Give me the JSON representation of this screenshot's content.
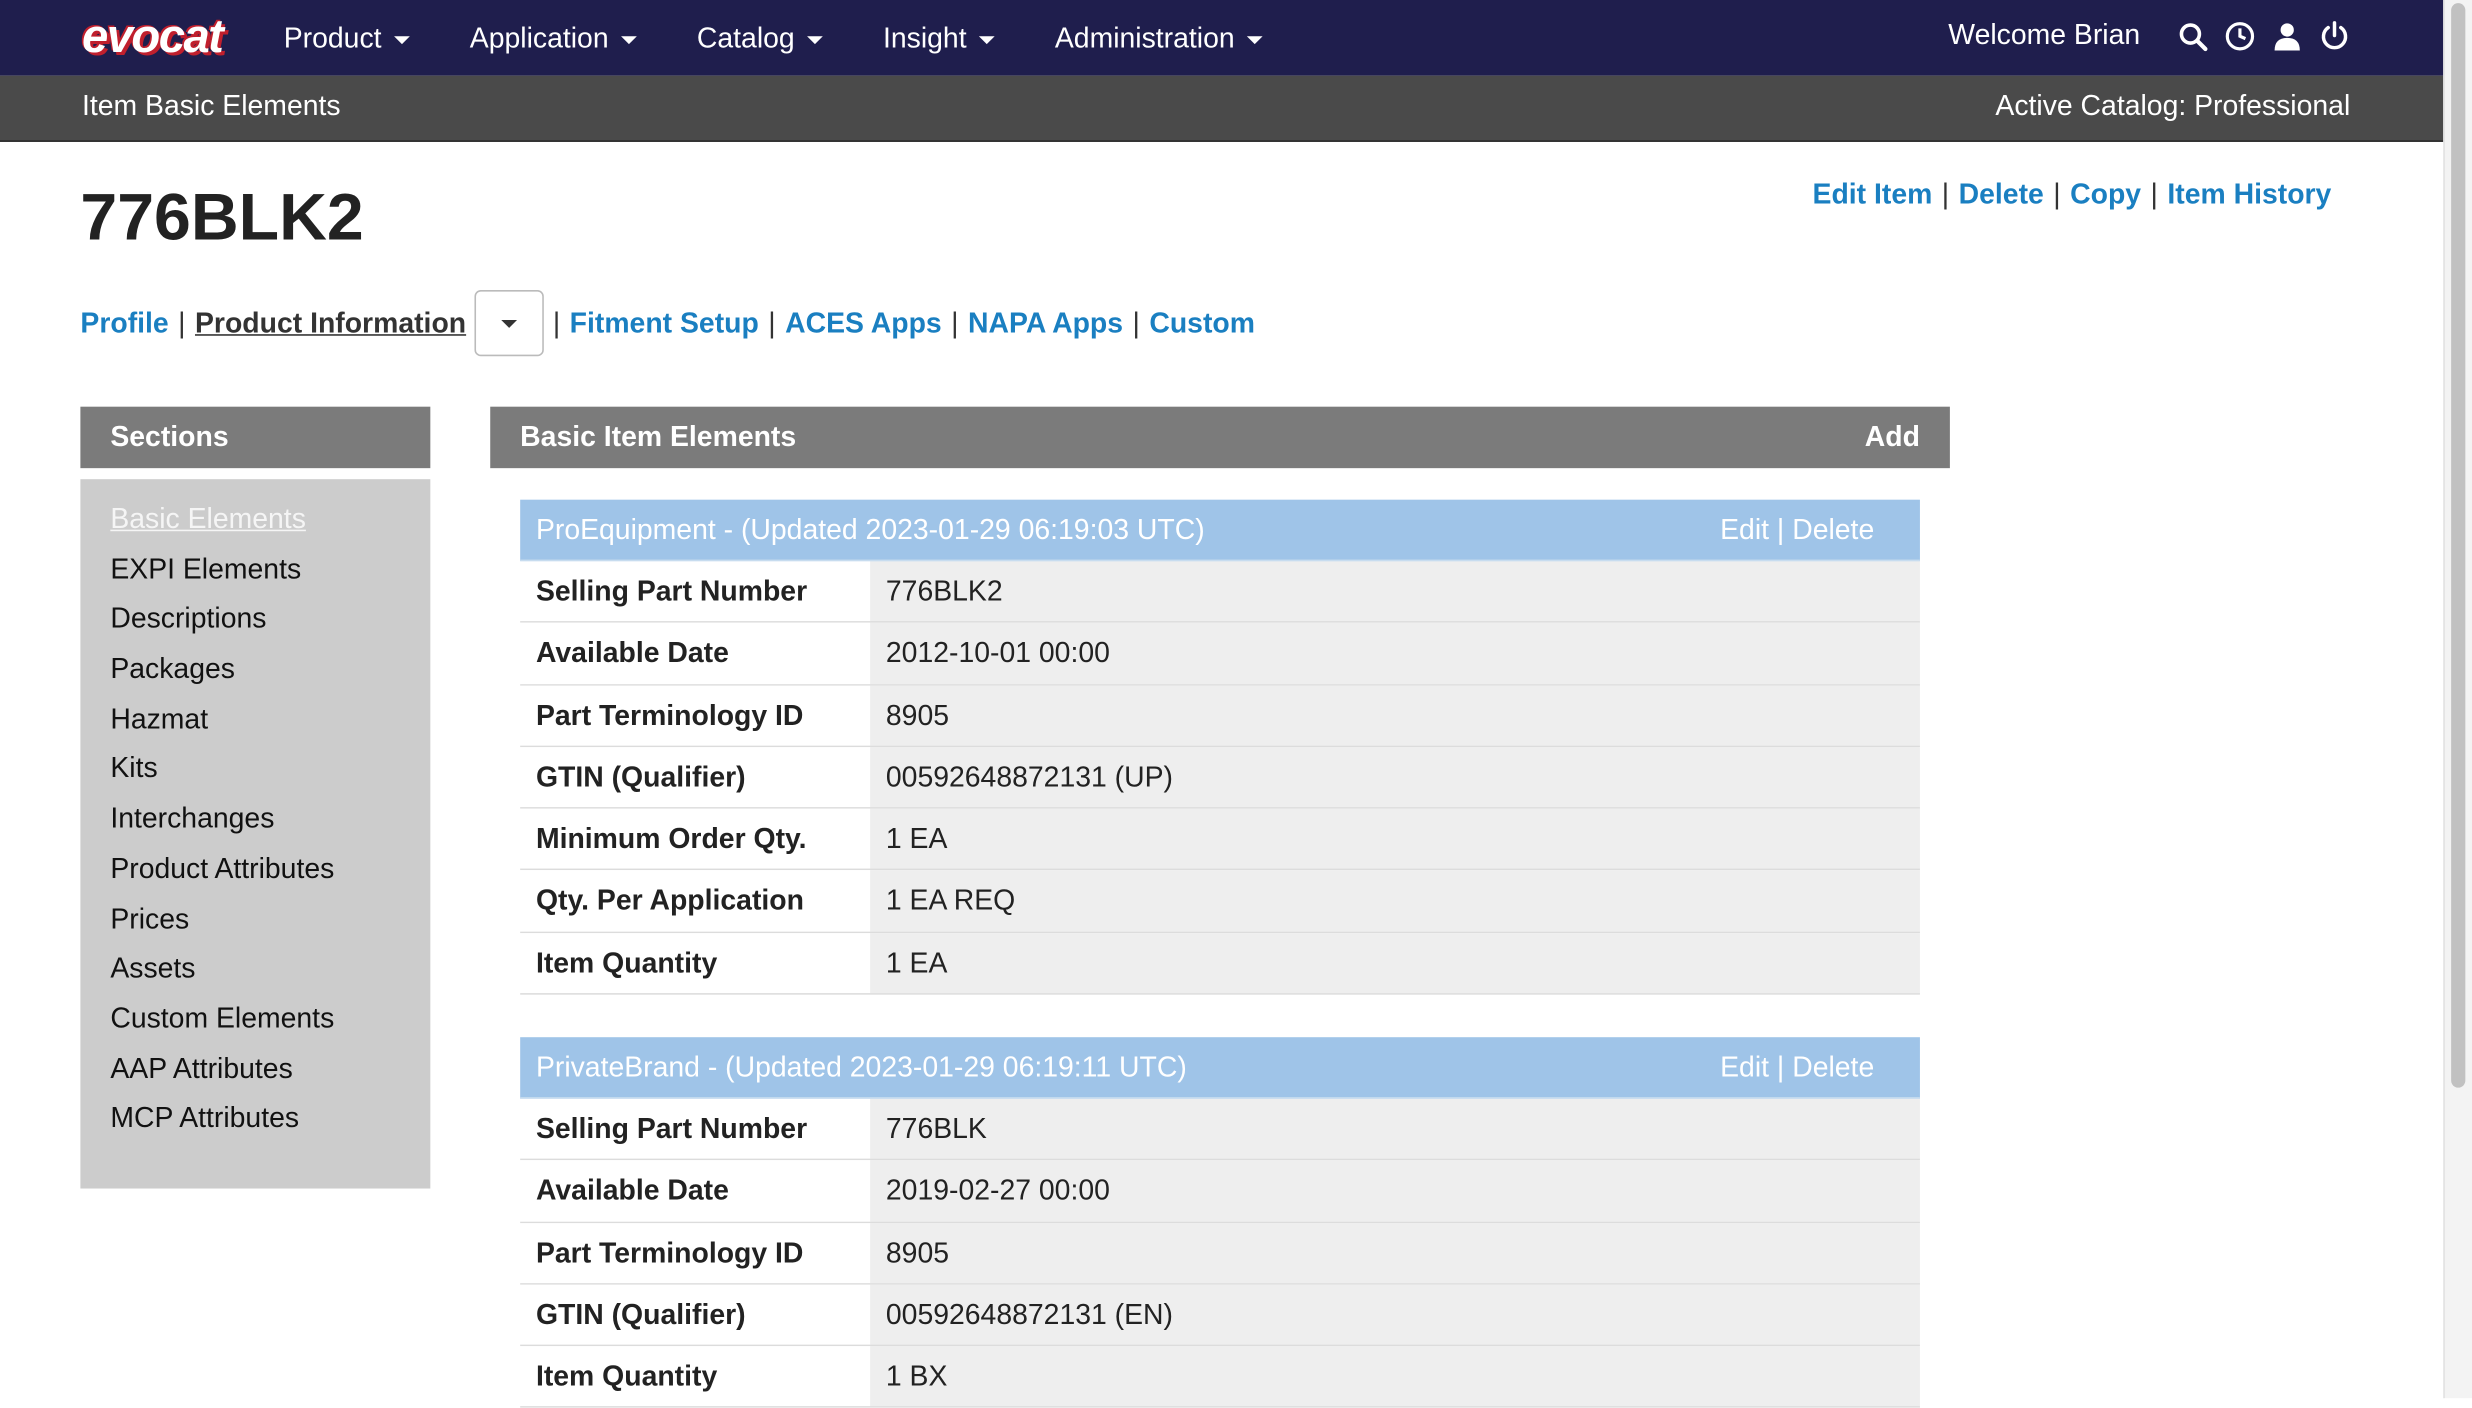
{
  "brand": {
    "logo_text": "evocat"
  },
  "nav": {
    "menus": [
      "Product",
      "Application",
      "Catalog",
      "Insight",
      "Administration"
    ],
    "welcome": "Welcome Brian",
    "icons": [
      "search-icon",
      "clock-icon",
      "user-icon",
      "power-icon"
    ]
  },
  "subbar": {
    "title": "Item Basic Elements",
    "catalog": "Active Catalog: Professional"
  },
  "item": {
    "title": "776BLK2",
    "actions": [
      "Edit Item",
      "Delete",
      "Copy",
      "Item History"
    ]
  },
  "tabs": {
    "profile": "Profile",
    "product_information": "Product Information",
    "fitment_setup": "Fitment Setup",
    "aces_apps": "ACES Apps",
    "napa_apps": "NAPA Apps",
    "custom": "Custom"
  },
  "sections": {
    "title": "Sections",
    "items": [
      "Basic Elements",
      "EXPI Elements",
      "Descriptions",
      "Packages",
      "Hazmat",
      "Kits",
      "Interchanges",
      "Product Attributes",
      "Prices",
      "Assets",
      "Custom Elements",
      "AAP Attributes",
      "MCP Attributes"
    ]
  },
  "main": {
    "title": "Basic Item Elements",
    "add_label": "Add",
    "edit_label": "Edit",
    "delete_label": "Delete",
    "cards": [
      {
        "header": "ProEquipment - (Updated 2023-01-29 06:19:03 UTC)",
        "rows": [
          {
            "label": "Selling Part Number",
            "value": "776BLK2"
          },
          {
            "label": "Available Date",
            "value": "2012-10-01 00:00"
          },
          {
            "label": "Part Terminology ID",
            "value": "8905"
          },
          {
            "label": "GTIN (Qualifier)",
            "value": "00592648872131 (UP)"
          },
          {
            "label": "Minimum Order Qty.",
            "value": "1 EA"
          },
          {
            "label": "Qty. Per Application",
            "value": "1 EA REQ"
          },
          {
            "label": "Item Quantity",
            "value": "1 EA"
          }
        ]
      },
      {
        "header": "PrivateBrand - (Updated 2023-01-29 06:19:11 UTC)",
        "rows": [
          {
            "label": "Selling Part Number",
            "value": "776BLK"
          },
          {
            "label": "Available Date",
            "value": "2019-02-27 00:00"
          },
          {
            "label": "Part Terminology ID",
            "value": "8905"
          },
          {
            "label": "GTIN (Qualifier)",
            "value": "00592648872131 (EN)"
          },
          {
            "label": "Item Quantity",
            "value": "1 BX"
          }
        ]
      }
    ]
  }
}
